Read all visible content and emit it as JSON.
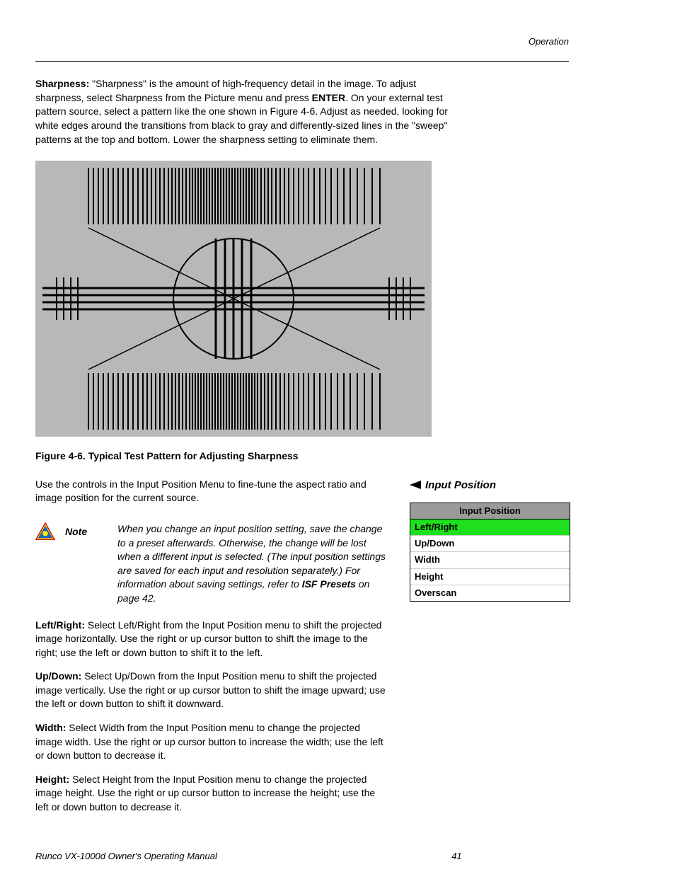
{
  "header": {
    "section": "Operation"
  },
  "sharpness": {
    "label": "Sharpness:",
    "text": " \"Sharpness\" is the amount of high-frequency detail in the image. To adjust sharpness, select Sharpness from the Picture menu and press ",
    "enter": "ENTER",
    "text2": ". On your external test pattern source, select a pattern like the one shown in Figure 4-6. Adjust as needed, looking for white edges around the transitions from black to gray and differently-sized lines in the \"sweep\" patterns at the top and bottom. Lower the sharpness setting to eliminate them."
  },
  "figure_caption": "Figure 4-6. Typical Test Pattern for Adjusting Sharpness",
  "input_position_intro": "Use the controls in the Input Position Menu to fine-tune the aspect ratio and image position for the current source.",
  "side_heading": "Input Position",
  "menu": {
    "title": "Input Position",
    "items": [
      "Left/Right",
      "Up/Down",
      "Width",
      "Height",
      "Overscan"
    ]
  },
  "note": {
    "label": "Note",
    "text": "When you change an input position setting, save the change to a preset afterwards. Otherwise, the change will be lost when a different input is selected. (The input position settings are saved for each input and resolution separately.) For information about saving settings, refer to ",
    "link": "ISF Presets",
    "tail": " on page 42."
  },
  "left_right": {
    "label": "Left/Right:",
    "text": " Select Left/Right from the Input Position menu to shift the projected image horizontally. Use the right or up cursor button to shift the image to the right; use the left or down button to shift it to the left."
  },
  "up_down": {
    "label": "Up/Down:",
    "text": " Select Up/Down from the Input Position menu to shift the projected image vertically. Use the right or up cursor button to shift the image upward; use the left or down button to shift it downward."
  },
  "width": {
    "label": "Width:",
    "text": " Select Width from the Input Position menu to change the projected image width. Use the right or up cursor button to increase the width; use the left or down button to decrease it."
  },
  "height": {
    "label": "Height:",
    "text": " Select Height from the Input Position menu to change the projected image height. Use the right or up cursor button to increase the height; use the left or down button to decrease it."
  },
  "footer": {
    "left": "Runco VX-1000d Owner's Operating Manual",
    "page": "41"
  }
}
